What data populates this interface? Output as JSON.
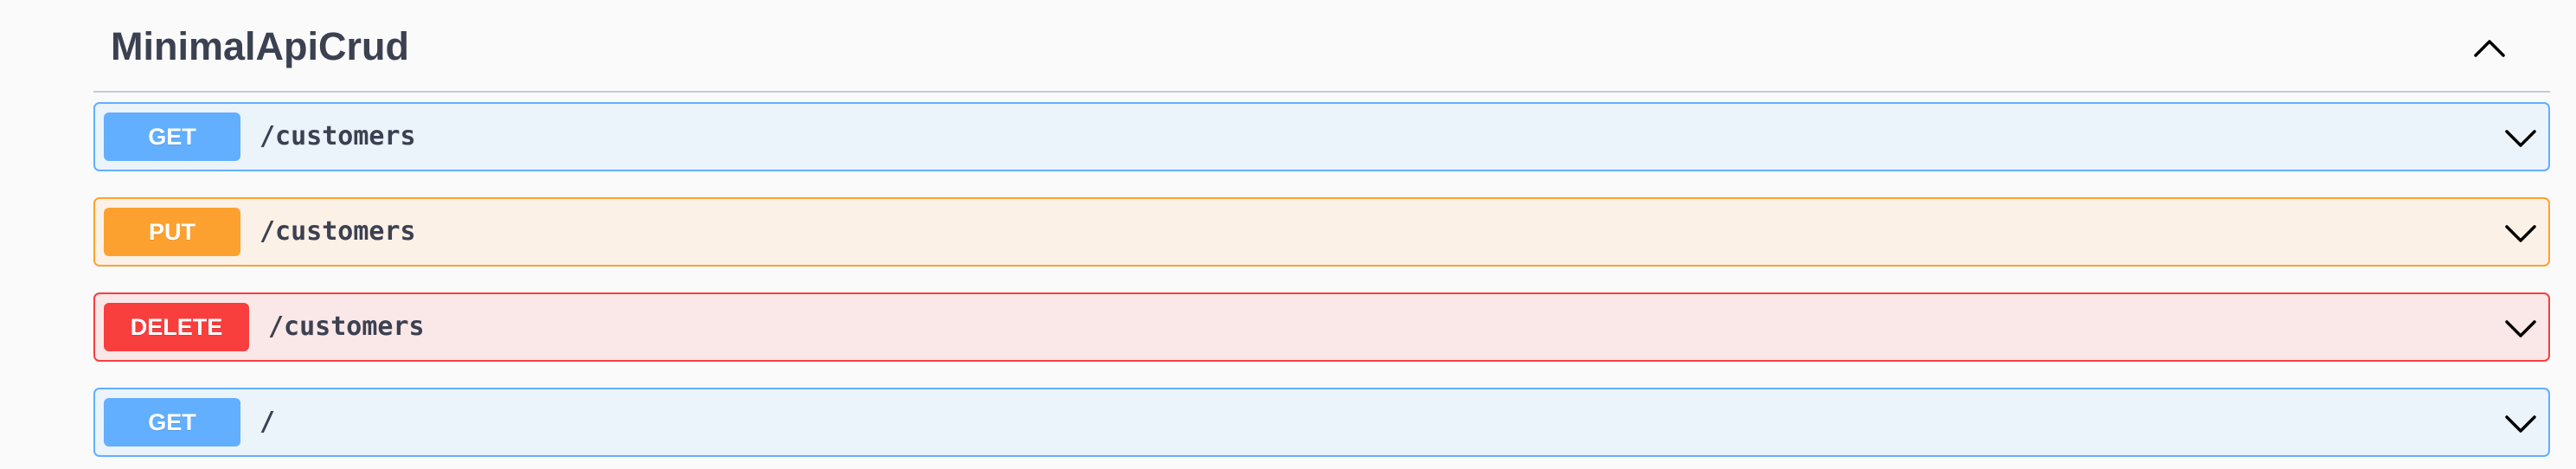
{
  "tag": {
    "title": "MinimalApiCrud"
  },
  "operations": [
    {
      "method": "GET",
      "path": "/customers",
      "color": "#61affe"
    },
    {
      "method": "PUT",
      "path": "/customers",
      "color": "#fca130"
    },
    {
      "method": "DELETE",
      "path": "/customers",
      "color": "#f93e3e"
    },
    {
      "method": "GET",
      "path": "/",
      "color": "#61affe"
    }
  ],
  "icons": {
    "collapse": "chevron-up-icon",
    "expand": "chevron-down-icon"
  }
}
